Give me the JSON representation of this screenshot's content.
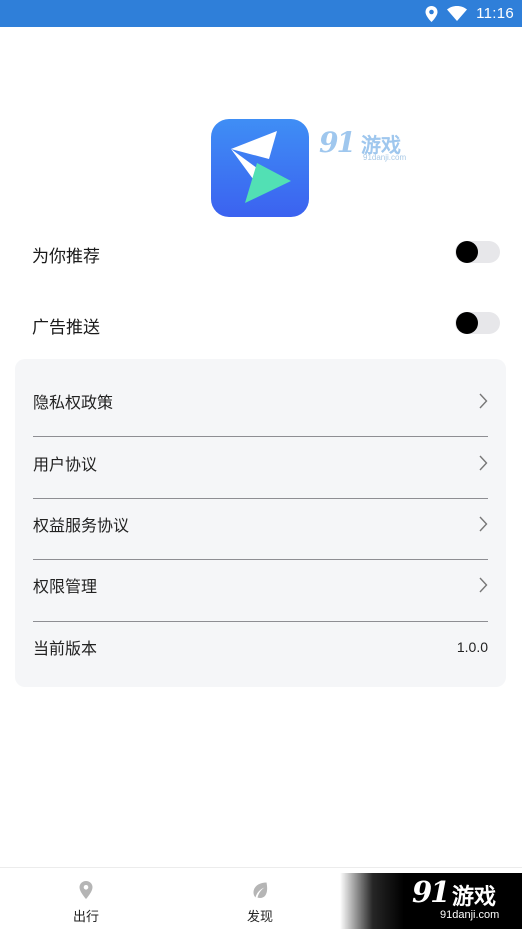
{
  "status_bar": {
    "time": "11:16",
    "icons": [
      "location-icon",
      "wifi-icon"
    ],
    "background_color": "#2f7fd9"
  },
  "brand": {
    "logo_icon": "lightning-play-logo-icon",
    "logo_colors": [
      "#3f8ef5",
      "#3b62f0",
      "#52e0b4"
    ]
  },
  "watermark": {
    "number": "91",
    "text": "游戏",
    "url": "91danji.com"
  },
  "toggles": [
    {
      "label": "为你推荐",
      "enabled": false
    },
    {
      "label": "广告推送",
      "enabled": false
    }
  ],
  "settings": {
    "items": [
      {
        "label": "隐私权政策",
        "icon": "chevron-right-icon"
      },
      {
        "label": "用户协议",
        "icon": "chevron-right-icon"
      },
      {
        "label": "权益服务协议",
        "icon": "chevron-right-icon"
      },
      {
        "label": "权限管理",
        "icon": "chevron-right-icon"
      }
    ],
    "version": {
      "label": "当前版本",
      "value": "1.0.0"
    }
  },
  "bottom_nav": {
    "items": [
      {
        "label": "出行",
        "icon": "location-pin-icon"
      },
      {
        "label": "发现",
        "icon": "leaf-icon"
      }
    ]
  }
}
